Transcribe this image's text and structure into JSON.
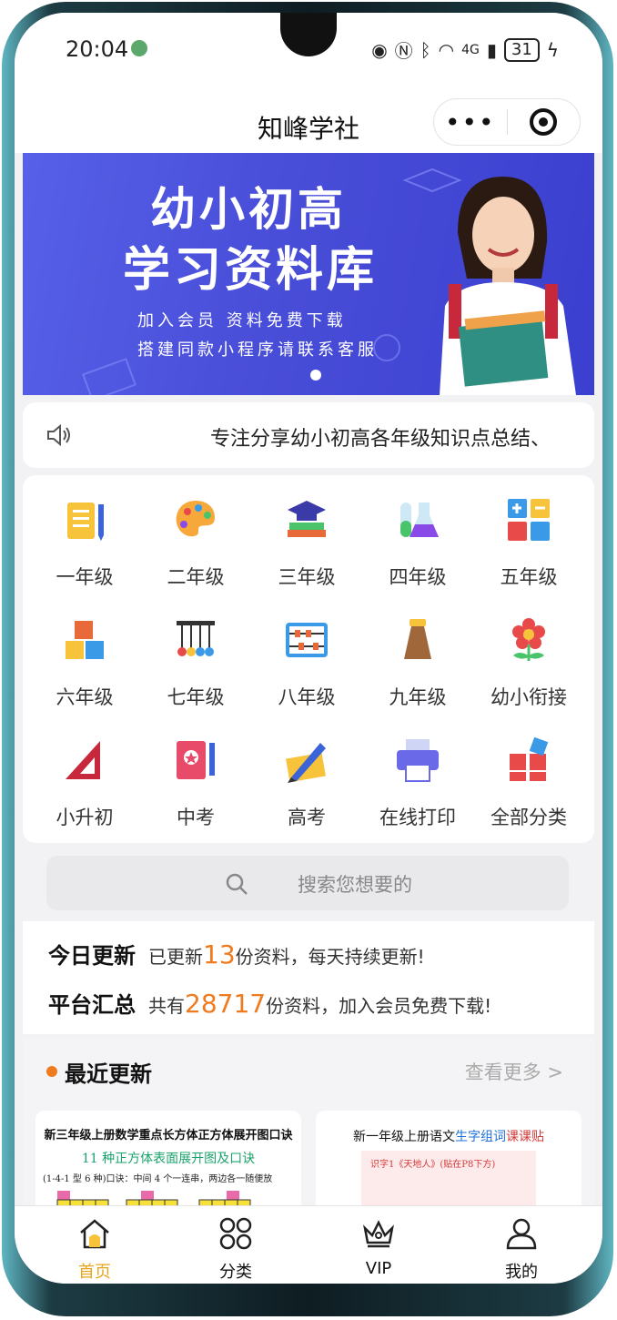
{
  "status": {
    "time": "20:04",
    "network": "4G",
    "battery": "31"
  },
  "nav": {
    "title": "知峰学社",
    "more_label": "•••"
  },
  "banner": {
    "title_line1": "幼小初高",
    "title_line2": "学习资料库",
    "subtitle_line1": "加入会员 资料免费下载",
    "subtitle_line2": "搭建同款小程序请联系客服"
  },
  "notice": {
    "text": "专注分享幼小初高各年级知识点总结、"
  },
  "categories": [
    {
      "label": "一年级",
      "icon": "notebook-icon"
    },
    {
      "label": "二年级",
      "icon": "palette-icon"
    },
    {
      "label": "三年级",
      "icon": "graduation-cap-icon"
    },
    {
      "label": "四年级",
      "icon": "flask-icon"
    },
    {
      "label": "五年级",
      "icon": "math-symbols-icon"
    },
    {
      "label": "六年级",
      "icon": "blocks-icon"
    },
    {
      "label": "七年级",
      "icon": "pendulum-icon"
    },
    {
      "label": "八年级",
      "icon": "abacus-icon"
    },
    {
      "label": "九年级",
      "icon": "bottle-icon"
    },
    {
      "label": "幼小衔接",
      "icon": "flower-icon"
    },
    {
      "label": "小升初",
      "icon": "set-square-icon"
    },
    {
      "label": "中考",
      "icon": "book-pencil-icon"
    },
    {
      "label": "高考",
      "icon": "pen-writing-icon"
    },
    {
      "label": "在线打印",
      "icon": "printer-icon"
    },
    {
      "label": "全部分类",
      "icon": "all-categories-icon"
    }
  ],
  "search": {
    "placeholder": "搜索您想要的"
  },
  "stats": {
    "today_title": "今日更新",
    "today_prefix": "已更新",
    "today_count": "13",
    "today_suffix": "份资料，每天持续更新!",
    "total_title": "平台汇总",
    "total_prefix": "共有",
    "total_count": "28717",
    "total_suffix": "份资料，加入会员免费下载!"
  },
  "recent": {
    "title": "最近更新",
    "more_label": "查看更多 >",
    "cards": [
      {
        "title": "新三年级上册数学重点长方体正方体展开图口诀",
        "subtitle": "11 种正方体表面展开图及口诀",
        "line": "(1-4-1 型 6 种)口诀：中间 4 个一连串，两边各一随便放"
      },
      {
        "title_a": "新一年级上册语文",
        "title_b": "生字组词",
        "title_c": "课课贴",
        "line": "识字1《天地人》(贴在P8下方)"
      }
    ]
  },
  "tabbar": {
    "items": [
      {
        "label": "首页",
        "icon": "home-icon",
        "active": true
      },
      {
        "label": "分类",
        "icon": "category-grid-icon",
        "active": false
      },
      {
        "label": "VIP",
        "icon": "crown-icon",
        "active": false
      },
      {
        "label": "我的",
        "icon": "user-icon",
        "active": false
      }
    ]
  },
  "colors": {
    "accent": "#f07a1e",
    "tab_active": "#e6a51a",
    "banner": "#4a4fd9"
  }
}
